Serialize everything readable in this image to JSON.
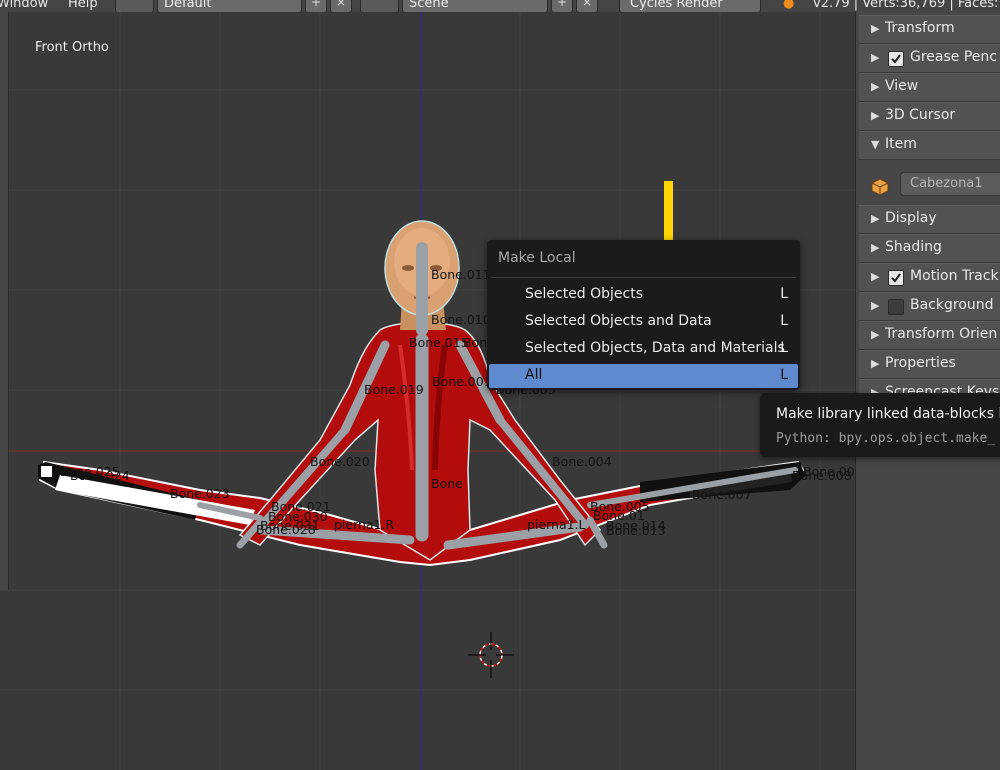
{
  "header": {
    "menu_window": "Window",
    "menu_help": "Help",
    "screen_layout": "Default",
    "scene": "Scene",
    "render_engine": "Cycles Render",
    "version_stats": "v2.79 | Verts:36,769 | Faces:"
  },
  "viewport": {
    "view_label": "Front Ortho",
    "key_overlay": "L",
    "bones": [
      "Bone.011",
      "Bone.010",
      "Bone.015",
      "Bone.027",
      "Bone.001",
      "Bone.019",
      "Bone.003",
      "Bone.020",
      "Bone.004",
      "Bone",
      "Bone.025",
      "Bone.024",
      "Bone.023",
      "Bone.021",
      "Bone.030",
      "Bone.031",
      "Bone.028",
      "pierna1.R",
      "pierna1.L",
      "Bone.005",
      "Bone.01",
      "Bone.014",
      "Bone.013",
      "Bone.007",
      "Bone.00",
      "Bone.008"
    ]
  },
  "menu": {
    "title": "Make Local",
    "items": [
      {
        "label": "Selected Objects",
        "shortcut": "L"
      },
      {
        "label": "Selected Objects and Data",
        "shortcut": "L"
      },
      {
        "label": "Selected Objects, Data and Materials",
        "shortcut": "L"
      },
      {
        "label": "All",
        "shortcut": "L"
      }
    ]
  },
  "tooltip": {
    "description": "Make library linked data-blocks loc",
    "python": "Python: bpy.ops.object.make_"
  },
  "panel": {
    "transform": "Transform",
    "grease_pencil": "Grease Penc",
    "view": "View",
    "cursor_3d": "3D Cursor",
    "item": "Item",
    "object_name": "Cabezona1",
    "display": "Display",
    "shading": "Shading",
    "motion_tracking": "Motion Track",
    "background": "Background",
    "transform_orientations": "Transform Orien",
    "properties": "Properties",
    "screencast_keys": "Screencast Keys"
  },
  "colors": {
    "menu_highlight": "#5f8ad0",
    "key_overlay": "#ffd400",
    "suit": "#b00000"
  }
}
